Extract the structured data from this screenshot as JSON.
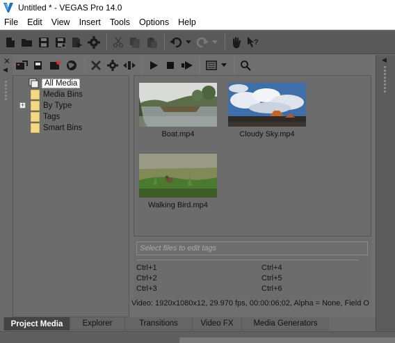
{
  "window": {
    "title": "Untitled * - VEGAS Pro 14.0"
  },
  "menu": {
    "items": [
      "File",
      "Edit",
      "View",
      "Insert",
      "Tools",
      "Options",
      "Help"
    ]
  },
  "toolbar": {
    "icons": [
      "new-icon",
      "open-icon",
      "save-icon",
      "save-as-icon",
      "render-icon",
      "properties-icon",
      "cut-icon",
      "copy-icon",
      "paste-icon",
      "undo-icon",
      "redo-icon",
      "hand-icon",
      "whats-this-icon"
    ]
  },
  "media_toolbar": {
    "icons": [
      "import-media-icon",
      "capture-video-icon",
      "get-media-from-web-icon",
      "remove-icon",
      "media-fx-icon",
      "auto-preview-icon",
      "play-icon",
      "stop-icon",
      "auto-play-icon",
      "views-icon",
      "search-icon"
    ]
  },
  "tree": {
    "items": [
      {
        "label": "All Media",
        "selected": true
      },
      {
        "label": "Media Bins"
      },
      {
        "label": "By Type",
        "expandable": true
      },
      {
        "label": "Tags"
      },
      {
        "label": "Smart Bins"
      }
    ],
    "expander_symbol": "+"
  },
  "media": {
    "items": [
      {
        "label": "Boat.mp4"
      },
      {
        "label": "Cloudy Sky.mp4"
      },
      {
        "label": "Walking Bird.mp4"
      }
    ]
  },
  "tags": {
    "placeholder": "Select files to edit tags",
    "shortcuts": [
      "Ctrl+1",
      "Ctrl+2",
      "Ctrl+3",
      "Ctrl+4",
      "Ctrl+5",
      "Ctrl+6"
    ]
  },
  "status": {
    "text": "Video: 1920x1080x12, 29.970 fps, 00:00:06;02, Alpha = None, Field O"
  },
  "tabs": {
    "items": [
      {
        "label": "Project Media",
        "active": true
      },
      {
        "label": "Explorer"
      },
      {
        "label": "Transitions"
      },
      {
        "label": "Video FX"
      },
      {
        "label": "Media Generators"
      }
    ]
  },
  "colors": {
    "panel": "#6c6c6c",
    "toolbar": "#595959",
    "folder": "#f4d886",
    "active_tab": "#444444"
  }
}
